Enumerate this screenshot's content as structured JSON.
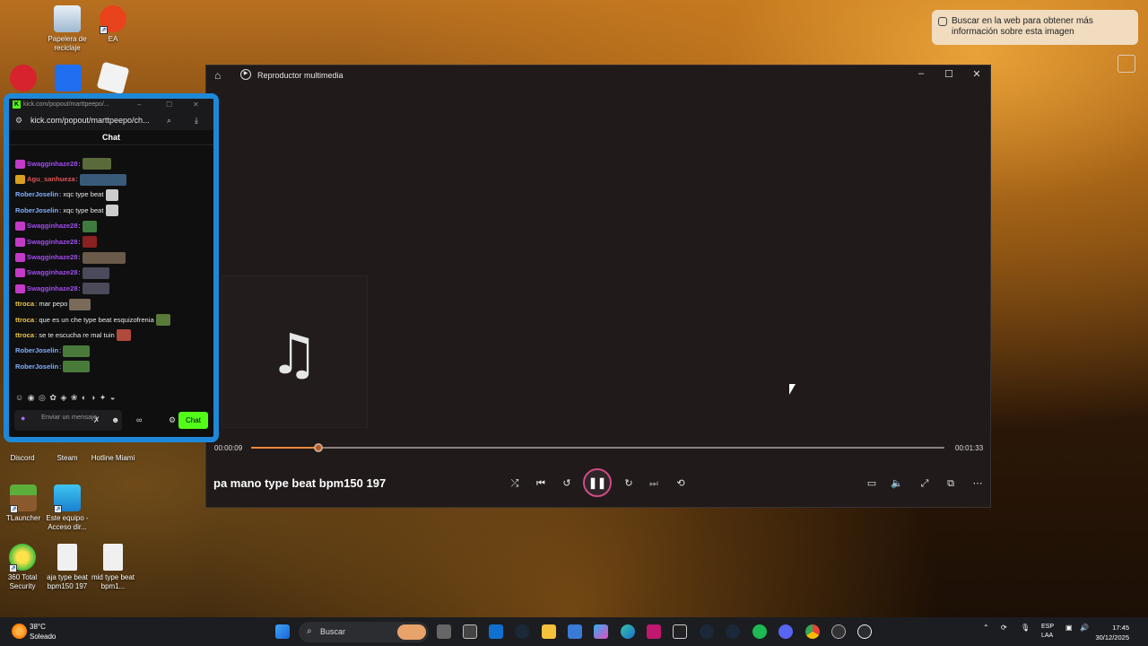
{
  "desktop": {
    "icons": [
      {
        "label": "Papelera de reciclaje"
      },
      {
        "label": "EA"
      },
      {
        "label": "Discord"
      },
      {
        "label": "Steam"
      },
      {
        "label": "Hotline Miami"
      },
      {
        "label": "TLauncher"
      },
      {
        "label": "Este equipo - Acceso dir..."
      },
      {
        "label": "360 Total Security"
      },
      {
        "label": "aja type beat bpm150 197"
      },
      {
        "label": "mid type beat bpm1..."
      }
    ]
  },
  "lens_toast": {
    "text": "Buscar en la web para obtener más información sobre esta imagen"
  },
  "player": {
    "title": "Reproductor multimedia",
    "song_title": "pa mano type beat bpm150 197",
    "time_current": "00:00:09",
    "time_total": "00:01:33",
    "progress_fraction": 0.097,
    "accent": "#f08a3c"
  },
  "chat": {
    "window_title": "kick.com/popout/marttpeepo/...",
    "address": "kick.com/popout/marttpeepo/ch...",
    "header": "Chat",
    "messages": [
      {
        "user": "Swagginhaze28",
        "text": ":",
        "color": "#a14cf0"
      },
      {
        "user": "Agu_sanhueza",
        "text": ":",
        "color": "#e05555"
      },
      {
        "user": "RoberJoselin",
        "text": ": xqc type beat",
        "color": "#7fb0ff"
      },
      {
        "user": "RoberJoselin",
        "text": ": xqc type beat",
        "color": "#7fb0ff"
      },
      {
        "user": "Swagginhaze28",
        "text": ":",
        "color": "#a14cf0"
      },
      {
        "user": "Swagginhaze28",
        "text": ":",
        "color": "#a14cf0"
      },
      {
        "user": "Swagginhaze28",
        "text": ":",
        "color": "#a14cf0"
      },
      {
        "user": "Swagginhaze28",
        "text": ":",
        "color": "#a14cf0"
      },
      {
        "user": "Swagginhaze28",
        "text": ":",
        "color": "#a14cf0"
      },
      {
        "user": "ttroca",
        "text": ": mar pepo",
        "color": "#e7c64a"
      },
      {
        "user": "ttroca",
        "text": ": que es un che type beat esquizofrenia",
        "color": "#e7c64a"
      },
      {
        "user": "ttroca",
        "text": ": se te escucha re mal tuin",
        "color": "#e7c64a"
      },
      {
        "user": "RoberJoselin",
        "text": ":",
        "color": "#7fb0ff"
      },
      {
        "user": "RoberJoselin",
        "text": ":",
        "color": "#7fb0ff"
      }
    ],
    "input_placeholder": "Enviar un mensaje",
    "send_label": "Chat",
    "accent": "#53fc18"
  },
  "taskbar": {
    "weather_temp": "38°C",
    "weather_desc": "Soleado",
    "search_placeholder": "Buscar",
    "lang_top": "ESP",
    "lang_bottom": "LAA",
    "time": "17:45",
    "date": "30/12/2025"
  }
}
